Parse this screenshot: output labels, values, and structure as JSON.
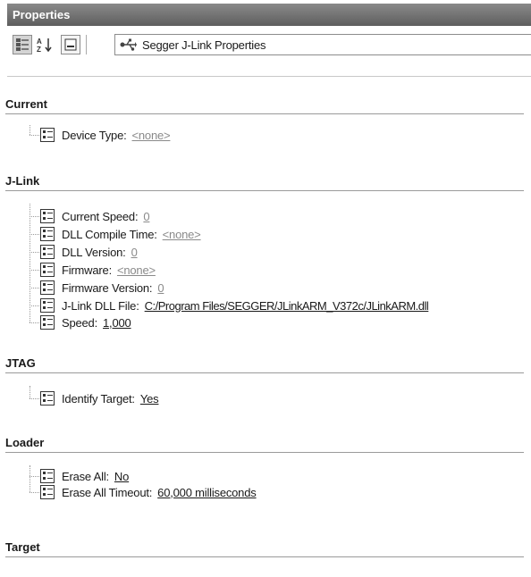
{
  "panel": {
    "title": "Properties"
  },
  "toolbar": {
    "categorized_icon": "categorized-icon",
    "alphabetical_icon": "sort-az-icon",
    "pages_icon": "property-pages-icon",
    "selector_icon": "usb-plug-icon",
    "selector_label": "Segger J-Link Properties"
  },
  "categories": [
    {
      "name": "Current",
      "properties": [
        {
          "label": "Device Type:",
          "value": "<none>"
        }
      ]
    },
    {
      "name": "J-Link",
      "properties": [
        {
          "label": "Current Speed:",
          "value": "0"
        },
        {
          "label": "DLL Compile Time:",
          "value": "<none>"
        },
        {
          "label": "DLL Version:",
          "value": "0"
        },
        {
          "label": "Firmware:",
          "value": "<none>"
        },
        {
          "label": "Firmware Version:",
          "value": "0"
        },
        {
          "label": "J-Link DLL File:",
          "value": "C:/Program Files/SEGGER/JLinkARM_V372c/JLinkARM.dll"
        },
        {
          "label": "Speed:",
          "value": "1,000"
        }
      ]
    },
    {
      "name": "JTAG",
      "properties": [
        {
          "label": "Identify Target:",
          "value": "Yes"
        }
      ]
    },
    {
      "name": "Loader",
      "properties": [
        {
          "label": "Erase All:",
          "value": "No"
        },
        {
          "label": "Erase All Timeout:",
          "value": "60,000 milliseconds"
        }
      ]
    },
    {
      "name": "Target",
      "properties": []
    }
  ],
  "colors": {
    "title_bar": "#6e6e6e",
    "none_value": "#8a8a8a",
    "divider": "#9a9a9a"
  }
}
